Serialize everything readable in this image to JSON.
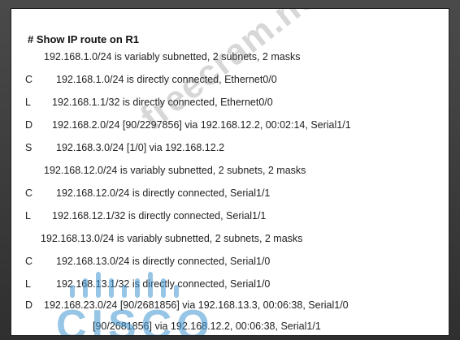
{
  "title": "# Show IP route on R1",
  "lines": [
    {
      "code": "",
      "text": "192.168.1.0/24 is variably subnetted, 2 subnets, 2 masks"
    },
    {
      "code": "C",
      "text": "192.168.1.0/24 is directly connected, Ethernet0/0"
    },
    {
      "code": "L",
      "text": "192.168.1.1/32 is directly connected, Ethernet0/0"
    },
    {
      "code": "D",
      "text": "192.168.2.0/24 [90/2297856] via 192.168.12.2, 00:02:14, Serial1/1"
    },
    {
      "code": "S",
      "text": "192.168.3.0/24 [1/0] via 192.168.12.2"
    },
    {
      "code": "",
      "text": "192.168.12.0/24 is variably subnetted, 2 subnets, 2 masks"
    },
    {
      "code": "C",
      "text": "192.168.12.0/24 is directly connected, Serial1/1"
    },
    {
      "code": "L",
      "text": "192.168.12.1/32 is directly connected, Serial1/1"
    },
    {
      "code": "",
      "text": "192.168.13.0/24 is variably subnetted, 2 subnets, 2 masks"
    },
    {
      "code": "C",
      "text": "192.168.13.0/24 is directly connected, Serial1/0"
    },
    {
      "code": "L",
      "text": "192.168.13.1/32 is directly connected, Serial1/0"
    },
    {
      "code": "D",
      "text": "192.168.23.0/24 [90/2681856] via 192.168.13.3, 00:06:38, Serial1/0"
    },
    {
      "code": "",
      "text": "[90/2681856] via 192.168.12.2, 00:06:38, Serial1/1"
    }
  ],
  "watermark": "freecram.net",
  "logo": "CISCO",
  "colors": {
    "logo": "#4096d2",
    "frame": "#3b3b3b",
    "panel": "#ffffff"
  }
}
